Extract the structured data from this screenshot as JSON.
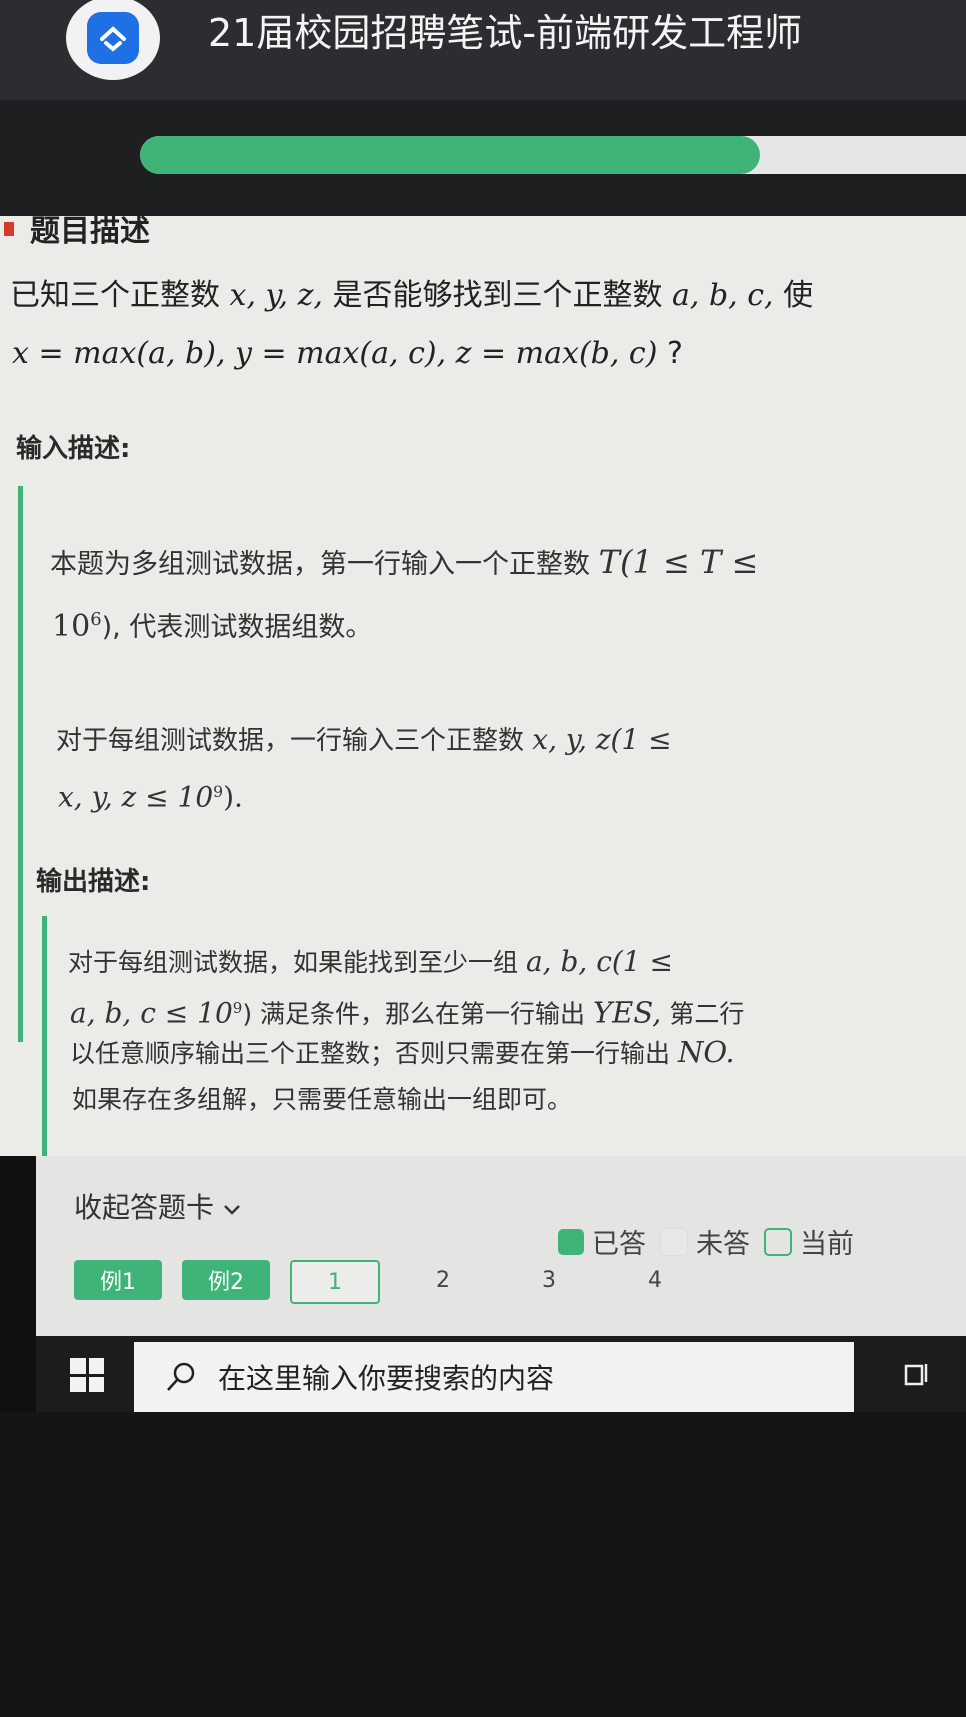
{
  "header": {
    "title": "21届校园招聘笔试-前端研发工程师",
    "progress_fraction": 0.75,
    "accent_color": "#3fb479"
  },
  "problem": {
    "section_title": "题目描述",
    "statement_line1_text": "已知三个正整数",
    "statement_line1_vars1": "x, y, z,",
    "statement_line1_mid": "是否能够找到三个正整数",
    "statement_line1_vars2": "a, b, c,",
    "statement_line1_end": "使",
    "statement_line2_math": "x = max(a, b), y = max(a, c), z = max(b, c)",
    "statement_line2_end": "?"
  },
  "input": {
    "heading": "输入描述:",
    "p1_text": "本题为多组测试数据，第一行输入一个正整数",
    "p1_math": "T(1 ≤ T ≤",
    "p1_line2_base": "10",
    "p1_line2_exp": "6",
    "p1_line2_text": "), 代表测试数据组数。",
    "p2_text": "对于每组测试数据，一行输入三个正整数",
    "p2_math": "x, y, z(1 ≤",
    "p2_line2_math": "x, y, z ≤ 10",
    "p2_line2_exp": "9",
    "p2_line2_end": ")."
  },
  "output": {
    "heading": "输出描述:",
    "line1_text": "对于每组测试数据，如果能找到至少一组",
    "line1_math": "a, b, c(1 ≤",
    "line2_math": "a, b, c ≤ 10",
    "line2_exp": "9",
    "line2_text": ") 满足条件，那么在第一行输出",
    "line2_yes": "YES,",
    "line2_end": "第二行",
    "line3_text": "以任意顺序输出三个正整数；否则只需要在第一行输出",
    "line3_no": "NO.",
    "line4_text": "如果存在多组解，只需要任意输出一组即可。"
  },
  "answer_card": {
    "collapse_label": "收起答题卡",
    "legend": {
      "answered": "已答",
      "unanswered": "未答",
      "current": "当前"
    },
    "tabs": [
      "例1",
      "例2",
      "1",
      "2",
      "3",
      "4"
    ]
  },
  "taskbar": {
    "search_placeholder": "在这里输入你要搜索的内容"
  }
}
